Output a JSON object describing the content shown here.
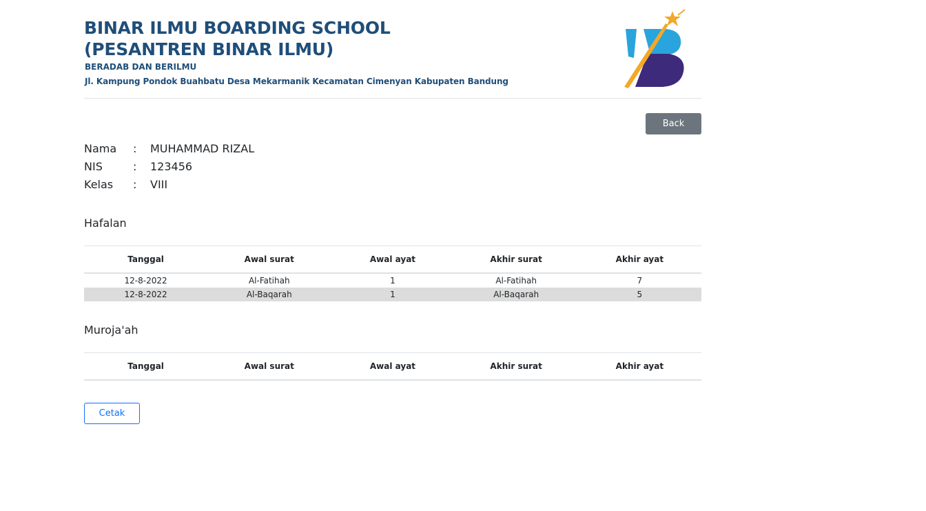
{
  "header": {
    "school_name_line1": "BINAR ILMU BOARDING SCHOOL",
    "school_name_line2": "(PESANTREN BINAR ILMU)",
    "motto": "BERADAB DAN BERILMU",
    "address": "Jl. Kampung Pondok Buahbatu Desa Mekarmanik Kecamatan Cimenyan Kabupaten Bandung",
    "logo_icon": "school-logo-icon",
    "brand_color": "#1f4e79"
  },
  "actions": {
    "back_label": "Back",
    "print_label": "Cetak"
  },
  "student": {
    "name_label": "Nama",
    "name_value": "MUHAMMAD RIZAL",
    "nis_label": "NIS",
    "nis_value": "123456",
    "class_label": "Kelas",
    "class_value": "VIII",
    "separator": ":"
  },
  "hafalan": {
    "title": "Hafalan",
    "columns": [
      "Tanggal",
      "Awal surat",
      "Awal ayat",
      "Akhir surat",
      "Akhir ayat"
    ],
    "rows": [
      [
        "12-8-2022",
        "Al-Fatihah",
        "1",
        "Al-Fatihah",
        "7"
      ],
      [
        "12-8-2022",
        "Al-Baqarah",
        "1",
        "Al-Baqarah",
        "5"
      ]
    ]
  },
  "murojaah": {
    "title": "Muroja'ah",
    "columns": [
      "Tanggal",
      "Awal surat",
      "Awal ayat",
      "Akhir surat",
      "Akhir ayat"
    ],
    "rows": []
  }
}
